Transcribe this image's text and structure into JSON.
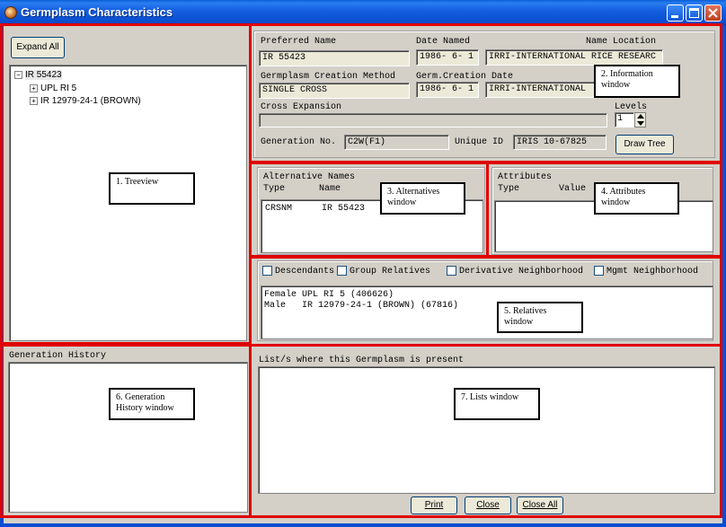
{
  "window": {
    "title": "Germplasm Characteristics"
  },
  "tree": {
    "expand_all_label": "Expand All",
    "root": "IR 55423",
    "children": [
      "UPL RI 5",
      "IR 12979-24-1 (BROWN)"
    ]
  },
  "info": {
    "preferred_name_label": "Preferred Name",
    "preferred_name_value": "IR 55423",
    "date_named_label": "Date Named",
    "date_named_value": "1986- 6- 1",
    "name_location_label": "Name Location",
    "name_location_value": "IRRI-INTERNATIONAL RICE RESEARC",
    "creation_method_label": "Germplasm Creation Method",
    "creation_method_value": "SINGLE CROSS",
    "creation_date_label": "Germ.Creation Date",
    "creation_date_value": "1986- 6- 1",
    "creation_location_value": "IRRI-INTERNATIONAL",
    "cross_expansion_label": "Cross Expansion",
    "cross_expansion_value": "",
    "levels_label": "Levels",
    "levels_value": "1",
    "generation_no_label": "Generation No.",
    "generation_no_value": "C2W(F1)",
    "unique_id_label": "Unique ID",
    "unique_id_value": "IRIS 10-67825",
    "draw_tree_label": "Draw Tree"
  },
  "alternatives": {
    "title": "Alternative Names",
    "col_type": "Type",
    "col_name": "Name",
    "rows": [
      {
        "type": "CRSNM",
        "name": "IR 55423"
      }
    ]
  },
  "attributes": {
    "title": "Attributes",
    "col_type": "Type",
    "col_value": "Value"
  },
  "relatives": {
    "descendants": "Descendants",
    "group_relatives": "Group Relatives",
    "derivative": "Derivative Neighborhood",
    "mgmt": "Mgmt Neighborhood",
    "lines": [
      "Female UPL RI 5 (406626)",
      "Male   IR 12979-24-1 (BROWN) (67816)"
    ]
  },
  "generation_history": {
    "title": "Generation History"
  },
  "lists": {
    "title": "List/s where this Germplasm is present",
    "print_label": "Print",
    "close_label": "Close",
    "close_all_label": "Close All"
  },
  "callouts": {
    "treeview": "1. Treeview",
    "information": "2. Information window",
    "alternatives": "3. Alternatives window",
    "attributes": "4. Attributes window",
    "relatives": "5. Relatives window",
    "generation_history": "6. Generation History window",
    "lists": "7. Lists window"
  },
  "colors": {
    "titlebar": "#0a4fd0",
    "annotation_border": "#e00000",
    "window_bg": "#d4d0c8"
  },
  "icons": [
    "app-icon",
    "minimize-icon",
    "maximize-icon",
    "close-icon",
    "expand-plus-icon",
    "spin-up-icon",
    "spin-down-icon"
  ]
}
